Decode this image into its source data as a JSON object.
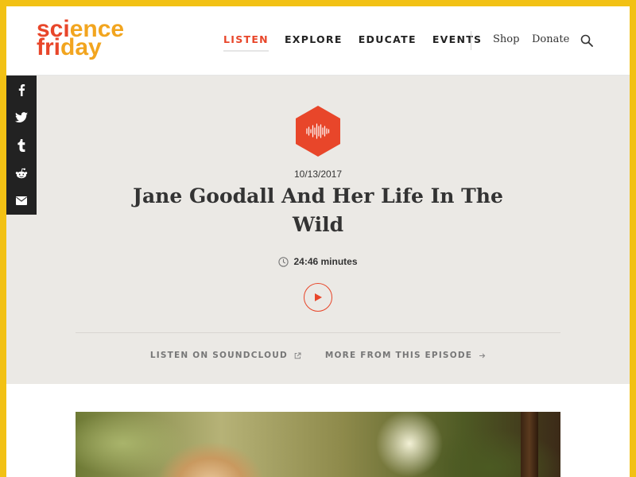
{
  "header": {
    "logo": {
      "line1_a": "sci",
      "line1_b": "ence",
      "line2_a": "fri",
      "line2_b": "day"
    },
    "nav": [
      {
        "label": "LISTEN",
        "active": true
      },
      {
        "label": "EXPLORE",
        "active": false
      },
      {
        "label": "EDUCATE",
        "active": false
      },
      {
        "label": "EVENTS",
        "active": false
      }
    ],
    "shop_label": "Shop",
    "donate_label": "Donate",
    "search_icon": "search-icon"
  },
  "social": [
    {
      "icon": "facebook-icon",
      "glyph": "f"
    },
    {
      "icon": "twitter-icon",
      "glyph": "t"
    },
    {
      "icon": "tumblr-icon",
      "glyph": "t"
    },
    {
      "icon": "reddit-icon",
      "glyph": "r"
    },
    {
      "icon": "email-icon",
      "glyph": "e"
    }
  ],
  "episode": {
    "date": "10/13/2017",
    "title": "Jane Goodall And Her Life In The Wild",
    "duration": "24:46 minutes",
    "soundcloud_label": "LISTEN ON SOUNDCLOUD",
    "more_label": "MORE FROM THIS EPISODE"
  },
  "colors": {
    "accent": "#e8462a",
    "logo_yellow": "#f2a51f",
    "frame": "#f2c114",
    "hero_bg": "#ebe9e5",
    "social_bg": "#222222"
  }
}
